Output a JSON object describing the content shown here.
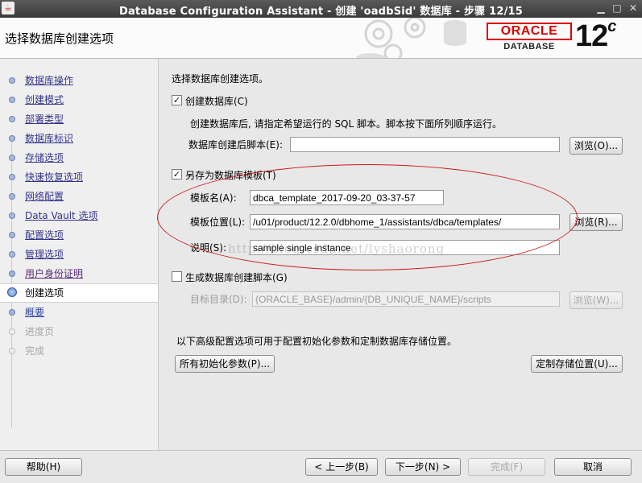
{
  "window": {
    "title": "Database Configuration Assistant - 创建 'oadbSid' 数据库 - 步骤 12/15",
    "icon": "java-icon"
  },
  "header": {
    "page_title": "选择数据库创建选项",
    "brand": "ORACLE",
    "product": "DATABASE",
    "version": "12",
    "version_suffix": "c",
    "brand_color": "#d00000"
  },
  "steps": [
    {
      "label": "数据库操作",
      "state": "visited"
    },
    {
      "label": "创建模式",
      "state": "visited"
    },
    {
      "label": "部署类型",
      "state": "visited"
    },
    {
      "label": "数据库标识",
      "state": "visited"
    },
    {
      "label": "存储选项",
      "state": "visited"
    },
    {
      "label": "快速恢复选项",
      "state": "visited"
    },
    {
      "label": "网络配置",
      "state": "visited"
    },
    {
      "label": "Data Vault 选项",
      "state": "visited"
    },
    {
      "label": "配置选项",
      "state": "visited"
    },
    {
      "label": "管理选项",
      "state": "visited"
    },
    {
      "label": "用户身份证明",
      "state": "link"
    },
    {
      "label": "创建选项",
      "state": "current"
    },
    {
      "label": "概要",
      "state": "next"
    },
    {
      "label": "进度页",
      "state": "future"
    },
    {
      "label": "完成",
      "state": "future"
    }
  ],
  "content": {
    "intro": "选择数据库创建选项。",
    "create_db": {
      "checked": true,
      "label": "创建数据库(C)",
      "description": "创建数据库后, 请指定希望运行的 SQL 脚本。脚本按下面所列顺序运行。",
      "post_script_label": "数据库创建后脚本(E):",
      "post_script_value": "",
      "browse_label": "浏览(O)..."
    },
    "save_template": {
      "checked": true,
      "label": "另存为数据库模板(T)",
      "name_label": "模板名(A):",
      "name_value": "dbca_template_2017-09-20_03-37-57",
      "location_label": "模板位置(L):",
      "location_value": "/u01/product/12.2.0/dbhome_1/assistants/dbca/templates/",
      "browse_label": "浏览(R)...",
      "desc_label": "说明(S):",
      "desc_value": "sample single instance"
    },
    "gen_scripts": {
      "checked": false,
      "label": "生成数据库创建脚本(G)",
      "dest_label": "目标目录(D):",
      "dest_value": "{ORACLE_BASE}/admin/{DB_UNIQUE_NAME}/scripts",
      "browse_label": "浏览(W)..."
    },
    "advanced_note": "以下高级配置选项可用于配置初始化参数和定制数据库存储位置。",
    "all_params_label": "所有初始化参数(P)...",
    "custom_storage_label": "定制存储位置(U)...",
    "watermark": "http://blog.csdn.net/lyshaorong",
    "annotation_color": "#d01818"
  },
  "footer": {
    "help": "帮助(H)",
    "back": "< 上一步(B)",
    "next": "下一步(N) >",
    "finish": "完成(F)",
    "cancel": "取消"
  }
}
